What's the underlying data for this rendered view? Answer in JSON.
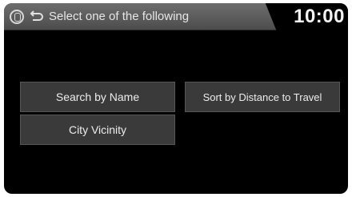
{
  "header": {
    "title": "Select one of the following",
    "clock": "10:00",
    "voice_icon": "voice-command-icon",
    "back_icon": "back-arrow-icon"
  },
  "options": [
    {
      "label": "Search by Name"
    },
    {
      "label": "Sort by Distance to Travel"
    },
    {
      "label": "City Vicinity"
    }
  ],
  "colors": {
    "header_bg": "#5a5a5a",
    "screen_bg": "#000000",
    "button_bg": "#3a3a3a",
    "text": "#ececec"
  }
}
